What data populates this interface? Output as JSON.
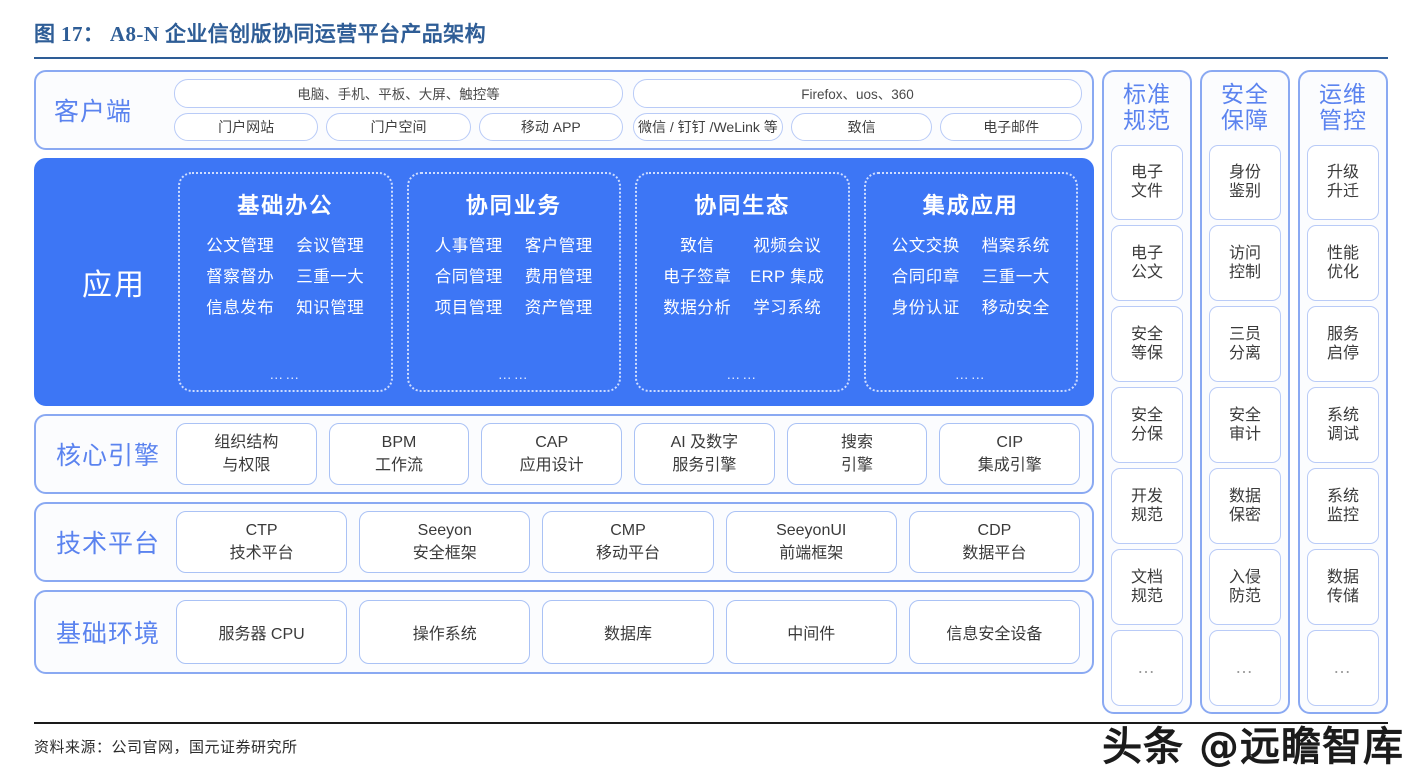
{
  "header": {
    "title": "图 17： A8-N 企业信创版协同运营平台产品架构"
  },
  "client_row": {
    "label": "客户端",
    "group_left": {
      "top": "电脑、手机、平板、大屏、触控等",
      "pills": [
        "门户网站",
        "门户空间",
        "移动 APP"
      ]
    },
    "group_right": {
      "top": "Firefox、uos、360",
      "pills": [
        "微信 / 钉钉 /WeLink 等",
        "致信",
        "电子邮件"
      ]
    }
  },
  "application": {
    "label": "应用",
    "cards": [
      {
        "title": "基础办公",
        "rows": [
          [
            "公文管理",
            "会议管理"
          ],
          [
            "督察督办",
            "三重一大"
          ],
          [
            "信息发布",
            "知识管理"
          ]
        ],
        "more": "……"
      },
      {
        "title": "协同业务",
        "rows": [
          [
            "人事管理",
            "客户管理"
          ],
          [
            "合同管理",
            "费用管理"
          ],
          [
            "项目管理",
            "资产管理"
          ]
        ],
        "more": "……"
      },
      {
        "title": "协同生态",
        "rows": [
          [
            "致信",
            "视频会议"
          ],
          [
            "电子签章",
            "ERP 集成"
          ],
          [
            "数据分析",
            "学习系统"
          ]
        ],
        "more": "……"
      },
      {
        "title": "集成应用",
        "rows": [
          [
            "公文交换",
            "档案系统"
          ],
          [
            "合同印章",
            "三重一大"
          ],
          [
            "身份认证",
            "移动安全"
          ]
        ],
        "more": "……"
      }
    ]
  },
  "core_engine": {
    "label": "核心引擎",
    "items": [
      {
        "line1": "组织结构",
        "line2": "与权限"
      },
      {
        "line1": "BPM",
        "line2": "工作流"
      },
      {
        "line1": "CAP",
        "line2": "应用设计"
      },
      {
        "line1": "AI 及数字",
        "line2": "服务引擎"
      },
      {
        "line1": "搜索",
        "line2": "引擎"
      },
      {
        "line1": "CIP",
        "line2": "集成引擎"
      }
    ]
  },
  "tech_platform": {
    "label": "技术平台",
    "items": [
      {
        "line1": "CTP",
        "line2": "技术平台"
      },
      {
        "line1": "Seeyon",
        "line2": "安全框架"
      },
      {
        "line1": "CMP",
        "line2": "移动平台"
      },
      {
        "line1": "SeeyonUI",
        "line2": "前端框架"
      },
      {
        "line1": "CDP",
        "line2": "数据平台"
      }
    ]
  },
  "base_env": {
    "label": "基础环境",
    "items": [
      "服务器 CPU",
      "操作系统",
      "数据库",
      "中间件",
      "信息安全设备"
    ]
  },
  "side_columns": [
    {
      "head": "标准\n规范",
      "items": [
        "电子\n文件",
        "电子\n公文",
        "安全\n等保",
        "安全\n分保",
        "开发\n规范",
        "文档\n规范",
        "…"
      ]
    },
    {
      "head": "安全\n保障",
      "items": [
        "身份\n鉴别",
        "访问\n控制",
        "三员\n分离",
        "安全\n审计",
        "数据\n保密",
        "入侵\n防范",
        "…"
      ]
    },
    {
      "head": "运维\n管控",
      "items": [
        "升级\n升迁",
        "性能\n优化",
        "服务\n启停",
        "系统\n调试",
        "系统\n监控",
        "数据\n传储",
        "…"
      ]
    }
  ],
  "footer": {
    "source": "资料来源：公司官网，国元证券研究所",
    "watermark": "头条 @远瞻智库"
  },
  "colors": {
    "title_blue": "#2e5d96",
    "accent_blue": "#3d76f5",
    "label_blue": "#5b83ef",
    "border_blue": "#8aa9f2",
    "box_border": "#b9cbf7"
  }
}
